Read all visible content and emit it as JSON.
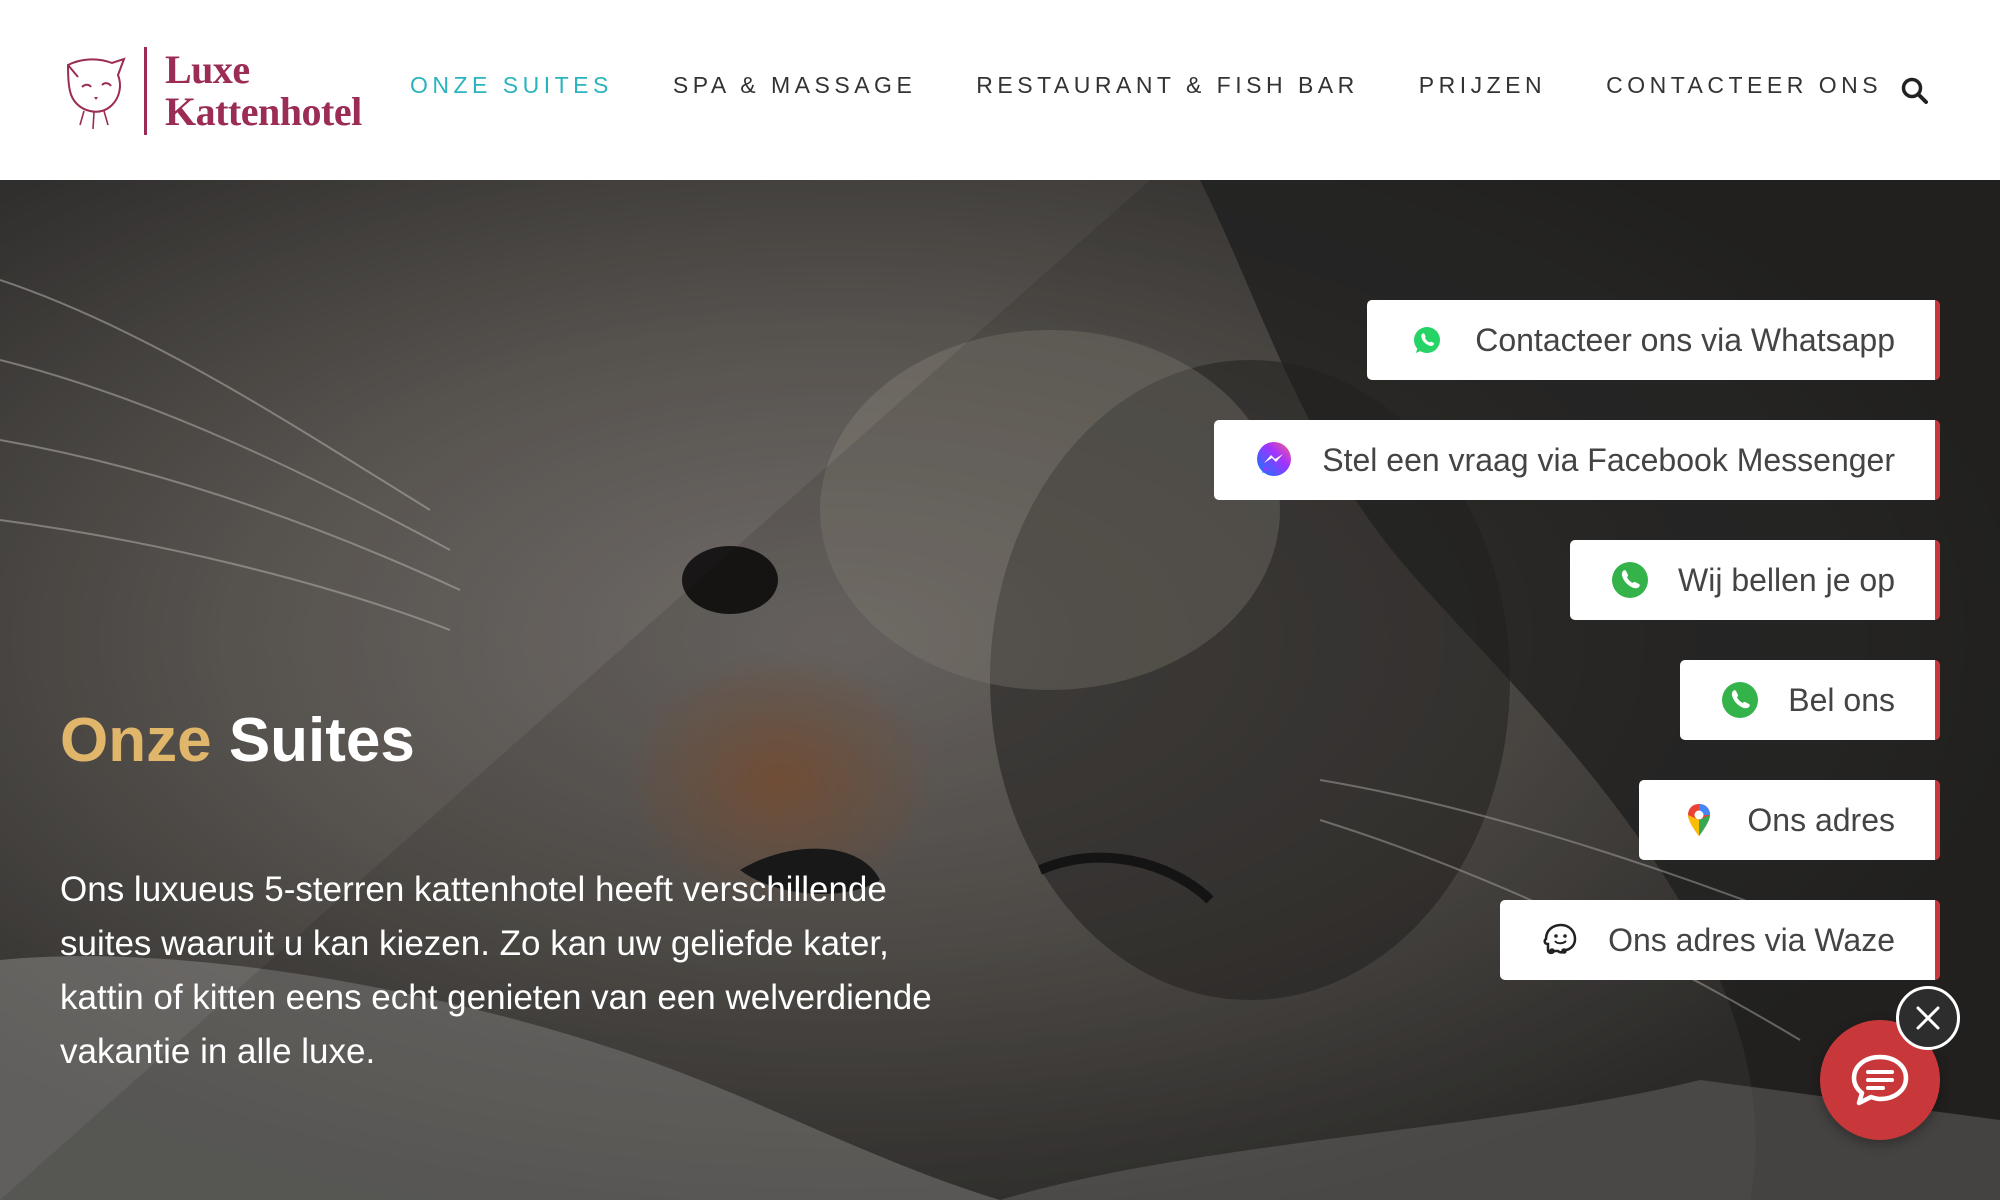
{
  "logo": {
    "line1": "Luxe",
    "line2": "Kattenhotel"
  },
  "nav": {
    "items": [
      {
        "label": "ONZE SUITES",
        "active": true
      },
      {
        "label": "SPA & MASSAGE",
        "active": false
      },
      {
        "label": "RESTAURANT & FISH BAR",
        "active": false
      },
      {
        "label": "PRIJZEN",
        "active": false
      },
      {
        "label": "CONTACTEER ONS",
        "active": false
      }
    ],
    "search_icon": "search-icon"
  },
  "hero": {
    "title_highlight": "Onze",
    "title_rest": "Suites",
    "description": "Ons luxueus 5-sterren kattenhotel heeft verschillende suites waaruit u kan kiezen. Zo kan uw geliefde kater, kattin of kitten eens echt genieten van een welverdiende vakantie in alle luxe."
  },
  "contact": {
    "items": [
      {
        "label": "Contacteer ons via Whatsapp",
        "icon": "whatsapp-icon"
      },
      {
        "label": "Stel een vraag via Facebook Messenger",
        "icon": "messenger-icon"
      },
      {
        "label": "Wij bellen je op",
        "icon": "phone-icon"
      },
      {
        "label": "Bel ons",
        "icon": "phone-icon"
      },
      {
        "label": "Ons adres",
        "icon": "map-pin-icon"
      },
      {
        "label": "Ons adres via Waze",
        "icon": "waze-icon"
      }
    ]
  },
  "colors": {
    "brand": "#9b2c55",
    "nav_active": "#2bb3c0",
    "title_gold": "#e0b66b",
    "accent_red": "#c8383a",
    "whatsapp_green": "#25d366"
  },
  "chat": {
    "open_icon": "chat-bubble-icon",
    "close_icon": "close-icon"
  }
}
